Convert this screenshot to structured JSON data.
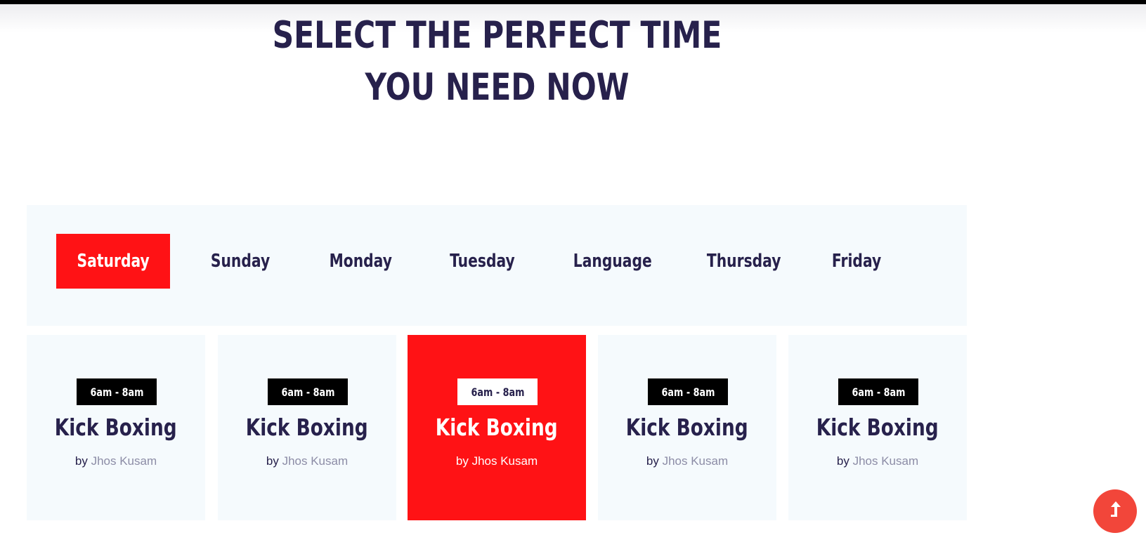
{
  "heading": {
    "line1": "SELECT THE PERFECT TIME",
    "line2": "YOU NEED NOW"
  },
  "days": [
    {
      "label": "Saturday",
      "active": true
    },
    {
      "label": "Sunday",
      "active": false
    },
    {
      "label": "Monday",
      "active": false
    },
    {
      "label": "Tuesday",
      "active": false
    },
    {
      "label": "Language",
      "active": false
    },
    {
      "label": "Thursday",
      "active": false
    },
    {
      "label": "Friday",
      "active": false
    }
  ],
  "classes": [
    {
      "time": "6am - 8am",
      "name": "Kick Boxing",
      "by": "by",
      "trainer": "Jhos Kusam",
      "highlighted": false
    },
    {
      "time": "6am - 8am",
      "name": "Kick Boxing",
      "by": "by",
      "trainer": "Jhos Kusam",
      "highlighted": false
    },
    {
      "time": "6am - 8am",
      "name": "Kick Boxing",
      "by": "by",
      "trainer": "Jhos Kusam",
      "highlighted": true
    },
    {
      "time": "6am - 8am",
      "name": "Kick Boxing",
      "by": "by",
      "trainer": "Jhos Kusam",
      "highlighted": false
    },
    {
      "time": "6am - 8am",
      "name": "Kick Boxing",
      "by": "by",
      "trainer": "Jhos Kusam",
      "highlighted": false
    }
  ],
  "scroll_top": {
    "icon": "arrow-up-icon"
  },
  "colors": {
    "accent": "#ff1215",
    "heading": "#27214c",
    "panel": "#f5fafd",
    "trainer_name": "#8c8ca6",
    "scroll_button": "#f2463a"
  }
}
